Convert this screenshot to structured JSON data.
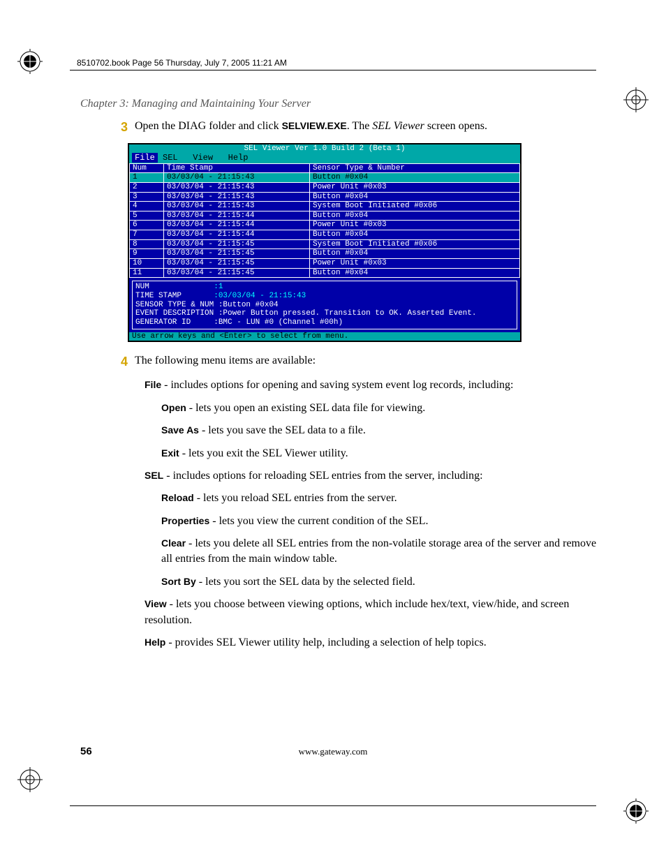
{
  "header_line": "8510702.book  Page 56  Thursday, July 7, 2005  11:21 AM",
  "chapter": "Chapter 3: Managing and Maintaining Your Server",
  "step3": {
    "num": "3",
    "pre": "Open the DIAG folder and click ",
    "exe": "SELVIEW.EXE",
    "mid": ". The ",
    "ital": "SEL Viewer",
    "post": " screen opens."
  },
  "screenshot": {
    "title": "SEL Viewer Ver 1.0 Build 2 (Beta 1)",
    "menu": {
      "file": "File",
      "sel": "SEL",
      "view": "View",
      "help": "Help"
    },
    "headers": {
      "num": "Num",
      "ts": "Time Stamp",
      "sensor": "Sensor Type & Number"
    },
    "rows": [
      {
        "n": "1",
        "ts": "03/03/04 - 21:15:43",
        "s": "Button #0x04"
      },
      {
        "n": "2",
        "ts": "03/03/04 - 21:15:43",
        "s": "Power Unit #0x03"
      },
      {
        "n": "3",
        "ts": "03/03/04 - 21:15:43",
        "s": "Button #0x04"
      },
      {
        "n": "4",
        "ts": "03/03/04 - 21:15:43",
        "s": "System Boot Initiated #0x06"
      },
      {
        "n": "5",
        "ts": "03/03/04 - 21:15:44",
        "s": "Button #0x04"
      },
      {
        "n": "6",
        "ts": "03/03/04 - 21:15:44",
        "s": "Power Unit #0x03"
      },
      {
        "n": "7",
        "ts": "03/03/04 - 21:15:44",
        "s": "Button #0x04"
      },
      {
        "n": "8",
        "ts": "03/03/04 - 21:15:45",
        "s": "System Boot Initiated #0x06"
      },
      {
        "n": "9",
        "ts": "03/03/04 - 21:15:45",
        "s": "Button #0x04"
      },
      {
        "n": "10",
        "ts": "03/03/04 - 21:15:45",
        "s": "Power Unit #0x03"
      },
      {
        "n": "11",
        "ts": "03/03/04 - 21:15:45",
        "s": "Button #0x04"
      }
    ],
    "detail": {
      "l1a": "NUM",
      "l1b": ":1",
      "l2a": "TIME STAMP",
      "l2b": ":03/03/04 - 21:15:43",
      "l3a": "SENSOR TYPE & NUM",
      "l3b": ":Button #0x04",
      "l4a": "EVENT DESCRIPTION",
      "l4b": ":Power Button pressed. Transition to OK. Asserted Event.",
      "l5a": "GENERATOR ID",
      "l5b": ":BMC - LUN #0 (Channel #00h)"
    },
    "footer": "Use arrow keys and <Enter> to select from menu."
  },
  "step4": {
    "num": "4",
    "text": "The following menu items are available:"
  },
  "menu": {
    "file": {
      "label": "File",
      "desc": " - includes options for opening and saving system event log records, including:"
    },
    "open": {
      "label": "Open",
      "desc": " - lets you open an existing SEL data file for viewing."
    },
    "saveas": {
      "label": "Save As",
      "desc": " - lets you save the SEL data to a file."
    },
    "exit": {
      "label": "Exit",
      "desc": " - lets you exit the SEL Viewer utility."
    },
    "sel": {
      "label": "SEL",
      "desc": " - includes options for reloading SEL entries from the server, including:"
    },
    "reload": {
      "label": "Reload",
      "desc": " - lets you reload SEL entries from the server."
    },
    "properties": {
      "label": "Properties",
      "desc": " - lets you view the current condition of the SEL."
    },
    "clear": {
      "label": "Clear",
      "desc": " - lets you delete all SEL entries from the non-volatile storage area of the server and remove all entries from the main window table."
    },
    "sortby": {
      "label": "Sort By",
      "desc": " - lets you sort the SEL data by the selected field."
    },
    "view": {
      "label": "View",
      "desc": " - lets you choose between viewing options, which include hex/text, view/hide, and screen resolution."
    },
    "help": {
      "label": "Help",
      "desc": " - provides SEL Viewer utility help, including a selection of help topics."
    }
  },
  "footer_url": "www.gateway.com",
  "page_number": "56"
}
